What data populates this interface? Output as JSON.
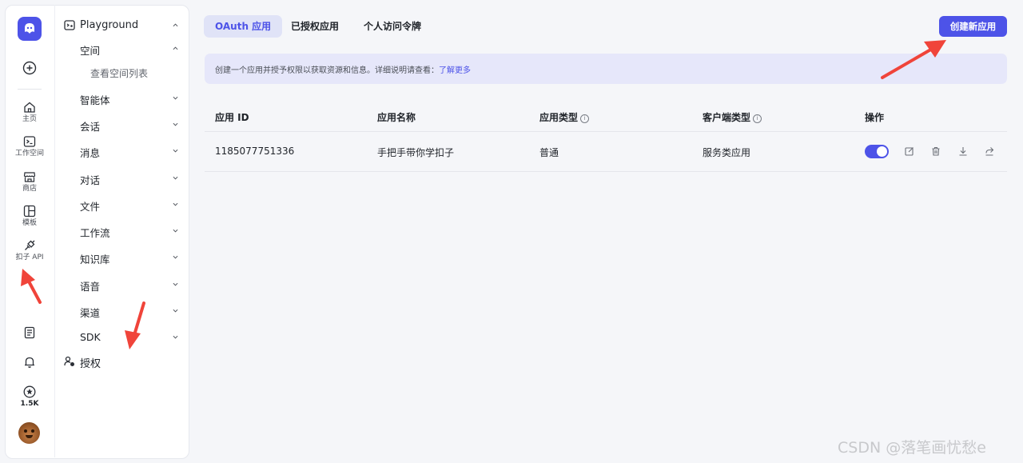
{
  "rail": {
    "items": [
      {
        "label": "主页",
        "icon": "home-icon"
      },
      {
        "label": "工作空间",
        "icon": "terminal-icon"
      },
      {
        "label": "商店",
        "icon": "store-icon"
      },
      {
        "label": "模板",
        "icon": "template-icon"
      },
      {
        "label": "扣子 API",
        "icon": "plug-icon"
      }
    ],
    "star_count": "1.5K"
  },
  "nav": {
    "playground": "Playground",
    "space": "空间",
    "space_list": "查看空间列表",
    "items": [
      "智能体",
      "会话",
      "消息",
      "对话",
      "文件",
      "工作流",
      "知识库",
      "语音",
      "渠道",
      "SDK"
    ],
    "auth": "授权"
  },
  "tabs": [
    "OAuth 应用",
    "已授权应用",
    "个人访问令牌"
  ],
  "create_button": "创建新应用",
  "banner": {
    "text": "创建一个应用并授予权限以获取资源和信息。详细说明请查看：",
    "link": "了解更多"
  },
  "table": {
    "headers": [
      "应用 ID",
      "应用名称",
      "应用类型",
      "客户端类型",
      "操作"
    ],
    "rows": [
      {
        "id": "1185077751336",
        "name": "手把手带你学扣子",
        "type": "普通",
        "client": "服务类应用",
        "enabled": true
      }
    ]
  },
  "watermark": "CSDN @落笔画忧愁e",
  "colors": {
    "accent": "#4d53e8",
    "annotation": "#f0443a"
  }
}
